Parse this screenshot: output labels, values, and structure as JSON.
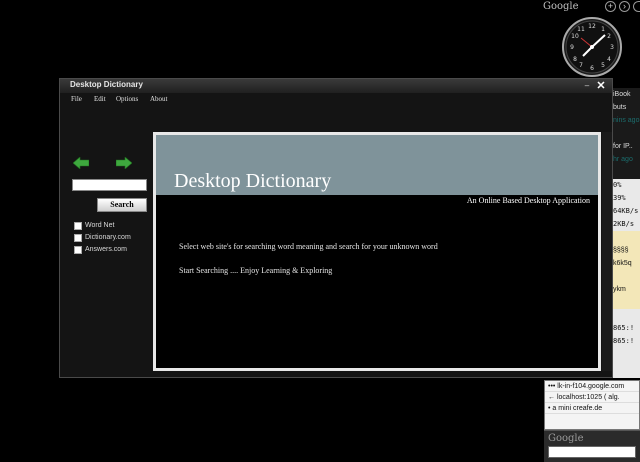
{
  "gadgets": {
    "brand": "Google",
    "sidebar_rows": [
      "iBook",
      "buts",
      "nins ago",
      "",
      "for IP..",
      "hr ago",
      "",
      "0%",
      "39%",
      "64KB/s",
      "2KB/s",
      "",
      "§§§§",
      "k6k5q",
      "",
      "ykm",
      "",
      "",
      "865:!",
      "865:!"
    ],
    "browser_rows": [
      "••• lk-in-f104.google.com",
      "← localhost:1025 ( alg.",
      "• a mini creafe.de"
    ],
    "search_title": "Google"
  },
  "window": {
    "title": "Desktop Dictionary",
    "minimize_glyph": "‒",
    "close_glyph": "✕",
    "menu": [
      "File",
      "Edit",
      "Options",
      "About"
    ]
  },
  "sidebar": {
    "search_value": "",
    "search_button": "Search",
    "options": [
      "Word Net",
      "Dictionary.com",
      "Answers.com"
    ]
  },
  "content": {
    "title": "Desktop Dictionary",
    "tagline": "An Online Based Desktop Application",
    "line1": "Select web site's for searching word meaning and search for your unknown word",
    "line2": "Start Searching .... Enjoy Learning & Exploring"
  },
  "colors": {
    "banner": "#7f939a",
    "arrow_green": "#3ea83e"
  }
}
